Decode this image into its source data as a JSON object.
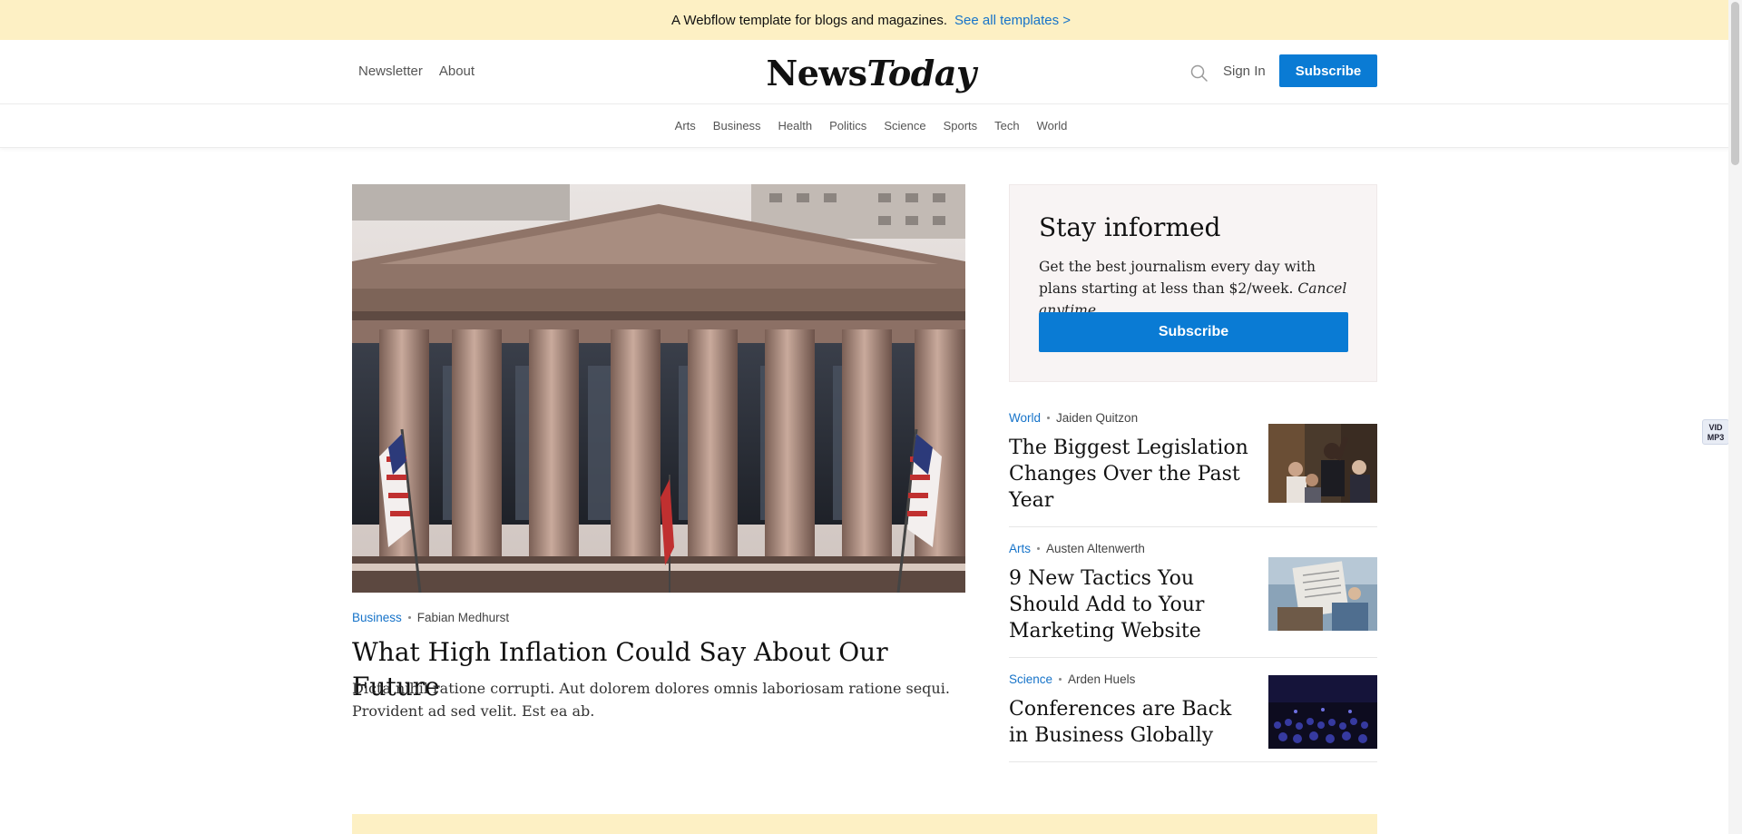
{
  "banner": {
    "text": "A Webflow template for blogs and magazines.",
    "link": "See all templates >"
  },
  "header": {
    "left_nav": [
      "Newsletter",
      "About"
    ],
    "logo_part1": "News",
    "logo_part2": "Today",
    "search_icon": "search-icon",
    "signin": "Sign In",
    "subscribe": "Subscribe"
  },
  "categories": [
    "Arts",
    "Business",
    "Health",
    "Politics",
    "Science",
    "Sports",
    "Tech",
    "World"
  ],
  "hero": {
    "category": "Business",
    "author": "Fabian Medhurst",
    "title": "What High Inflation Could Say About Our Future",
    "excerpt": "Dicta nihil ratione corrupti. Aut dolorem dolores omnis laboriosam ratione sequi. Provident ad sed velit. Est ea ab."
  },
  "promo": {
    "title": "Stay informed",
    "text": "Get the best journalism every day with plans starting at less than $2/week.",
    "text_em": "Cancel anytime.",
    "button": "Subscribe"
  },
  "articles": [
    {
      "category": "World",
      "author": "Jaiden Quitzon",
      "title": "The Biggest Legislation Changes Over the Past Year"
    },
    {
      "category": "Arts",
      "author": "Austen Altenwerth",
      "title": "9 New Tactics You Should Add to Your Marketing Website"
    },
    {
      "category": "Science",
      "author": "Arden Huels",
      "title": "Conferences are Back in Business Globally"
    }
  ],
  "extension_badge": {
    "line1": "VID",
    "line2": "MP3"
  },
  "colors": {
    "accent": "#0a7bd4",
    "link": "#1673c9",
    "banner_bg": "#fdf0c4",
    "promo_bg": "#f8f4f4"
  }
}
